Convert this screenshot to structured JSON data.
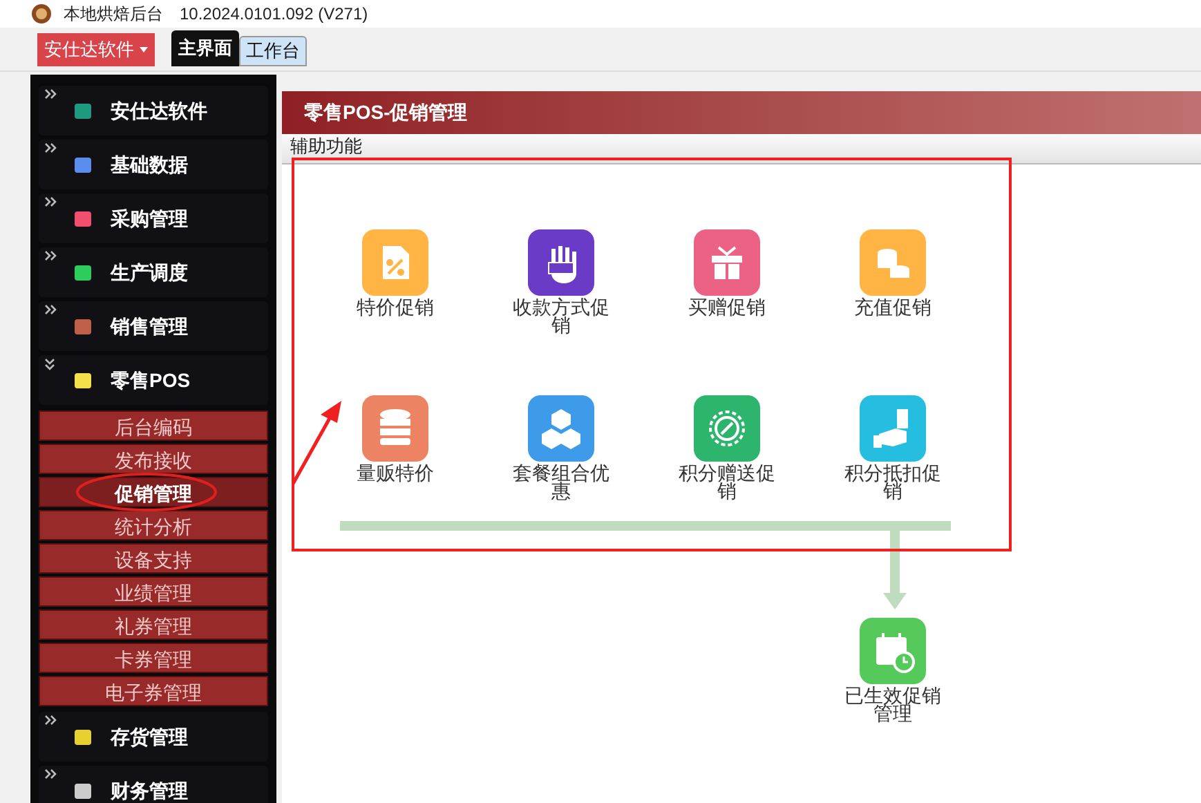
{
  "window": {
    "title": "本地烘焙后台",
    "version": "10.2024.0101.092 (V271)"
  },
  "toolbar": {
    "menu_button": "安仕达软件",
    "tabs": [
      {
        "label": "主界面",
        "selected": true
      },
      {
        "label": "工作台",
        "selected": false
      }
    ]
  },
  "sidebar": {
    "groups": [
      {
        "label": "安仕达软件",
        "color": "#1f9a7e",
        "expanded": false
      },
      {
        "label": "基础数据",
        "color": "#5b8def",
        "expanded": false
      },
      {
        "label": "采购管理",
        "color": "#f0506e",
        "expanded": false
      },
      {
        "label": "生产调度",
        "color": "#2ecc5a",
        "expanded": false
      },
      {
        "label": "销售管理",
        "color": "#c0604a",
        "expanded": false
      },
      {
        "label": "零售POS",
        "color": "#f5e04a",
        "expanded": true,
        "children": [
          {
            "label": "后台编码",
            "selected": false
          },
          {
            "label": "发布接收",
            "selected": false
          },
          {
            "label": "促销管理",
            "selected": true
          },
          {
            "label": "统计分析",
            "selected": false
          },
          {
            "label": "设备支持",
            "selected": false
          },
          {
            "label": "业绩管理",
            "selected": false
          },
          {
            "label": "礼券管理",
            "selected": false
          },
          {
            "label": "卡券管理",
            "selected": false
          },
          {
            "label": "电子券管理",
            "selected": false
          }
        ]
      },
      {
        "label": "存货管理",
        "color": "#e8d030",
        "expanded": false
      },
      {
        "label": "财务管理",
        "color": "#cccccc",
        "expanded": false
      }
    ]
  },
  "panel": {
    "title": "零售POS-促销管理",
    "subtitle": "辅助功能",
    "nodes": [
      {
        "label": "特价促销",
        "color": "#ffb443"
      },
      {
        "label": "收款方式促销",
        "color": "#6a3bc6"
      },
      {
        "label": "买赠促销",
        "color": "#ec6285"
      },
      {
        "label": "充值促销",
        "color": "#ffb443"
      },
      {
        "label": "量贩特价",
        "color": "#ec8363"
      },
      {
        "label": "套餐组合优惠",
        "color": "#3d9be9"
      },
      {
        "label": "积分赠送促销",
        "color": "#2db56e"
      },
      {
        "label": "积分抵扣促销",
        "color": "#25bde0"
      }
    ],
    "result": {
      "label": "已生效促销管理",
      "color": "#55c95a"
    }
  }
}
